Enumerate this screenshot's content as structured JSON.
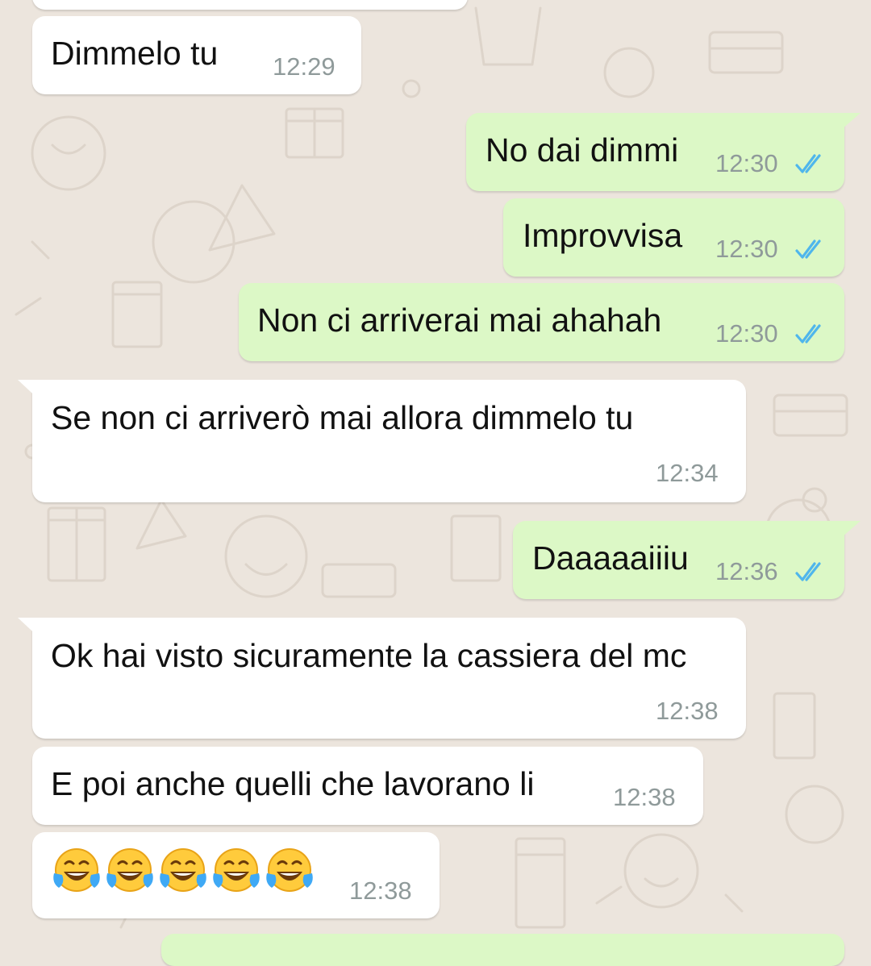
{
  "messages": [
    {
      "id": "m1",
      "direction": "incoming",
      "text": "Dimmelo tu",
      "time": "12:29"
    },
    {
      "id": "m2",
      "direction": "outgoing",
      "text": "No dai dimmi",
      "time": "12:30",
      "status": "read"
    },
    {
      "id": "m3",
      "direction": "outgoing",
      "text": "Improvvisa",
      "time": "12:30",
      "status": "read"
    },
    {
      "id": "m4",
      "direction": "outgoing",
      "text": "Non ci arriverai mai ahahah",
      "time": "12:30",
      "status": "read"
    },
    {
      "id": "m5",
      "direction": "incoming",
      "text": "Se non ci arriverò mai allora dimmelo tu",
      "time": "12:34"
    },
    {
      "id": "m6",
      "direction": "outgoing",
      "text": "Daaaaaiiiu",
      "time": "12:36",
      "status": "read"
    },
    {
      "id": "m7",
      "direction": "incoming",
      "text": "Ok hai visto sicuramente la cassiera del mc",
      "time": "12:38"
    },
    {
      "id": "m8",
      "direction": "incoming",
      "text": "E poi anche quelli che lavorano li",
      "time": "12:38"
    },
    {
      "id": "m9",
      "direction": "incoming",
      "text": "😂😂😂😂😂",
      "time": "12:38"
    }
  ],
  "colors": {
    "wallpaper": "#ece5dd",
    "incoming_bubble": "#ffffff",
    "outgoing_bubble": "#dcf8c6",
    "timestamp": "#8f9a9a",
    "read_ticks": "#4fb6ec"
  },
  "icons": {
    "read_receipt": "double-check-icon",
    "emoji": "face-with-tears-of-joy-icon"
  }
}
